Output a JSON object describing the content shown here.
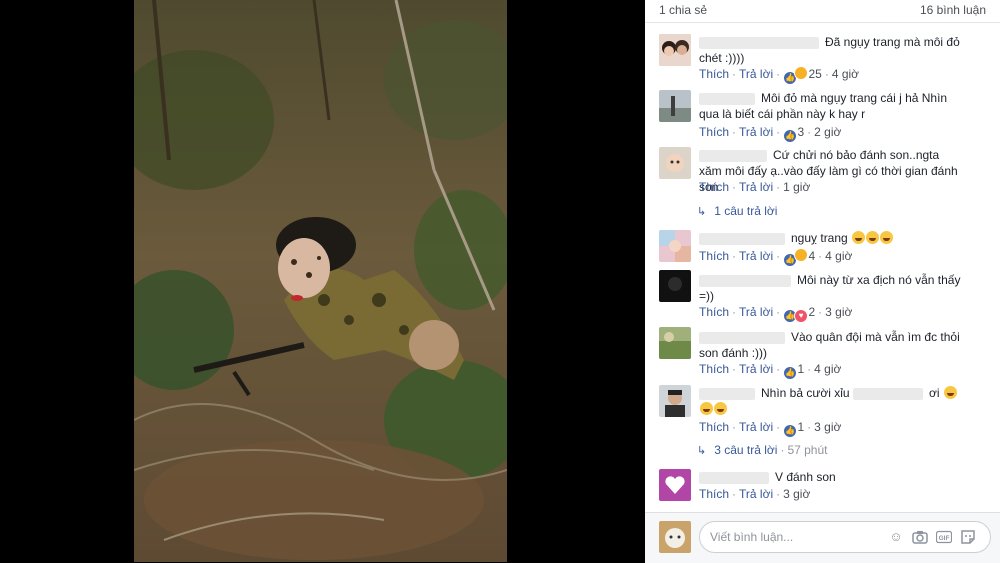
{
  "stats": {
    "shares": "1 chia sẻ",
    "comments": "16 bình luận"
  },
  "comments": [
    {
      "text": "Đã ngụy trang mà môi đỏ chét :))))",
      "like": "Thích",
      "reply": "Trả lời",
      "reactions": "25",
      "time": "4 giờ"
    },
    {
      "text": "Môi đỏ mà ngụy trang cái j hả Nhìn qua là biết cái phần này k hay r",
      "like": "Thích",
      "reply": "Trả lời",
      "reactions": "3",
      "time": "2 giờ"
    },
    {
      "text": "Cứ chửi nó bảo đánh son..ngta xăm môi đấy ạ..vào đấy làm gì có thời gian đánh son",
      "like": "Thích",
      "reply": "Trả lời",
      "time": "1 giờ",
      "replies": "1 câu trả lời"
    },
    {
      "text": "nguỵ trang",
      "like": "Thích",
      "reply": "Trả lời",
      "reactions": "4",
      "time": "4 giờ"
    },
    {
      "text": "Môi này từ xa địch nó vẫn thấy =))",
      "like": "Thích",
      "reply": "Trả lời",
      "reactions": "2",
      "time": "3 giờ"
    },
    {
      "text": "Vào quân đội mà vẫn ìm đc thỏi son đánh :)))",
      "like": "Thích",
      "reply": "Trả lời",
      "reactions": "1",
      "time": "4 giờ"
    },
    {
      "text": "Nhìn bả cười xỉu",
      "text_tail": "ơi",
      "like": "Thích",
      "reply": "Trả lời",
      "reactions": "1",
      "time": "3 giờ",
      "replies": "3 câu trả lời",
      "replies_time": "57 phút"
    },
    {
      "text": "V đánh son",
      "like": "Thích",
      "reply": "Trả lời",
      "time": "3 giờ"
    }
  ],
  "composer": {
    "placeholder": "Viết bình luận..."
  },
  "icons": [
    "like-icon",
    "haha-icon",
    "love-icon",
    "smiley-icon",
    "camera-icon",
    "gif-icon",
    "sticker-icon"
  ]
}
